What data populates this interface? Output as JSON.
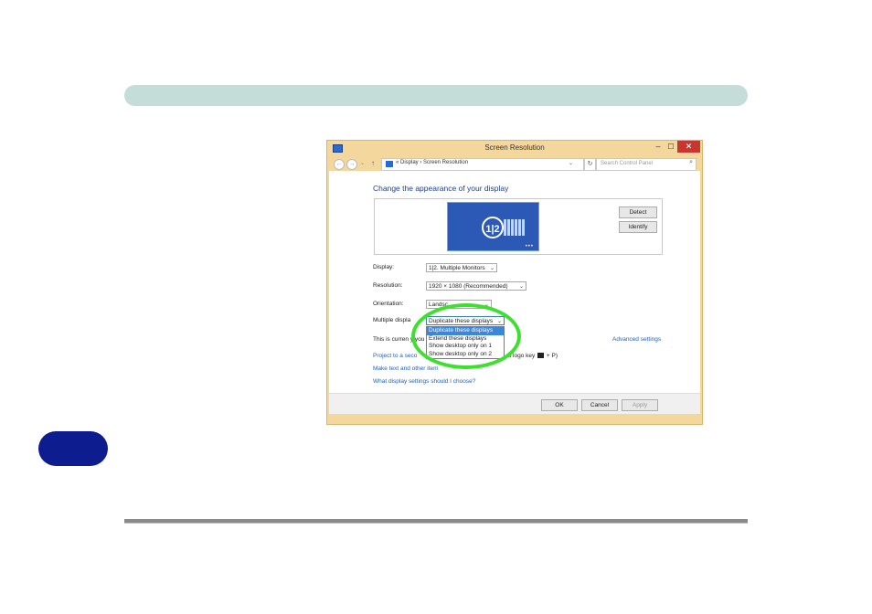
{
  "window": {
    "title": "Screen Resolution",
    "minimize": "–",
    "maximize": "☐",
    "close": "✕"
  },
  "address_bar": {
    "back": "←",
    "forward": "→",
    "up": "↑",
    "path": "« Display › Screen Resolution",
    "dropdown": "⌄",
    "refresh": "↻",
    "search_placeholder": "Search Control Panel",
    "search_icon": "⌕"
  },
  "content": {
    "heading": "Change the appearance of your display",
    "monitor_label": "1|2",
    "detect": "Detect",
    "identify": "Identify",
    "display_label": "Display:",
    "display_value": "1|2. Multiple Monitors",
    "resolution_label": "Resolution:",
    "resolution_value": "1920 × 1080 (Recommended)",
    "orientation_label": "Orientation:",
    "orientation_value": "Landsc",
    "multi_label": "Multiple displa",
    "multi_value": "Duplicate these displays",
    "dropdown_options": [
      "Duplicate these displays",
      "Extend these displays",
      "Show desktop only on 1",
      "Show desktop only on 2"
    ],
    "status_text": "This is curren  y you",
    "advanced_link": "Advanced settings",
    "link_project": "Project to a seco",
    "link_project_tail": "s logo key",
    "link_project_end": "+ P)",
    "link_text_size": "Make text and other item",
    "link_help": "What display settings should I choose?"
  },
  "footer": {
    "ok": "OK",
    "cancel": "Cancel",
    "apply": "Apply"
  },
  "colors": {
    "top_bar": "#c5ddd9",
    "side_tab": "#0d1c8f",
    "window_frame": "#f4d79c",
    "highlight": "#3de12d",
    "link": "#1f5fbf"
  }
}
